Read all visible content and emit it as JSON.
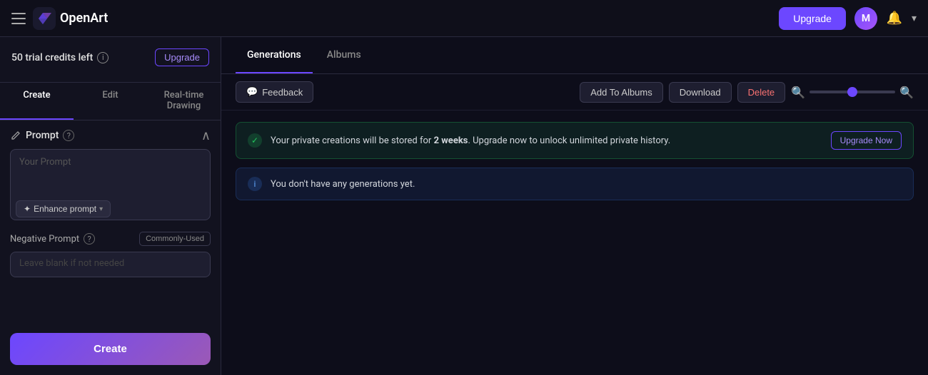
{
  "app": {
    "title": "OpenArt",
    "logo_alt": "OpenArt logo"
  },
  "nav": {
    "upgrade_label": "Upgrade",
    "bell_label": "🔔",
    "chevron_label": "▾"
  },
  "sidebar": {
    "credits": {
      "text": "50 trial credits left",
      "upgrade_btn": "Upgrade"
    },
    "tabs": [
      {
        "label": "Create",
        "active": true
      },
      {
        "label": "Edit",
        "active": false
      },
      {
        "label": "Real-time Drawing",
        "active": false
      }
    ],
    "prompt": {
      "label": "Prompt",
      "placeholder": "Your Prompt",
      "enhance_label": "Enhance prompt",
      "enhance_chevron": "▾"
    },
    "negative_prompt": {
      "label": "Negative Prompt",
      "placeholder": "Leave blank if not needed",
      "commonly_used_label": "Commonly-Used"
    },
    "create_btn": "Create"
  },
  "content": {
    "tabs": [
      {
        "label": "Generations",
        "active": true
      },
      {
        "label": "Albums",
        "active": false
      }
    ],
    "toolbar": {
      "feedback_label": "Feedback",
      "add_to_albums_label": "Add To Albums",
      "download_label": "Download",
      "delete_label": "Delete",
      "zoom_value": 50
    },
    "banners": [
      {
        "type": "green",
        "text": "Your private creations will be stored for ",
        "highlight": "2 weeks",
        "text2": ". Upgrade now to unlock unlimited private history.",
        "upgrade_btn": "Upgrade Now"
      },
      {
        "type": "blue",
        "text": "You don't have any generations yet."
      }
    ]
  }
}
